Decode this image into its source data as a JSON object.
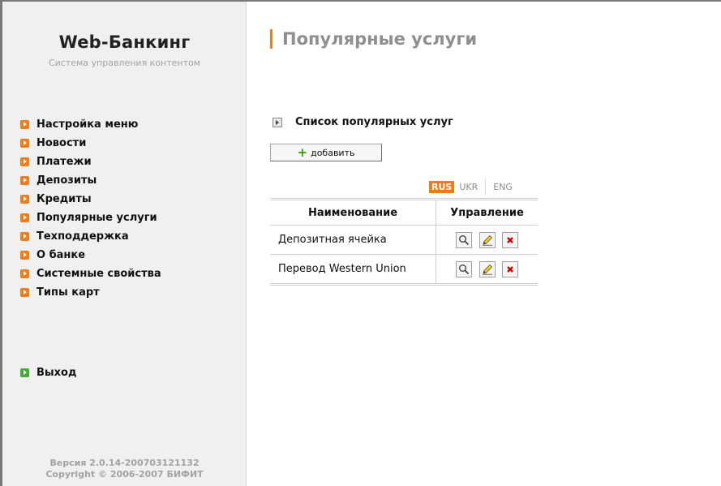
{
  "sidebar": {
    "brand_title": "Web-Банкинг",
    "brand_subtitle": "Система управления контентом",
    "items": [
      {
        "label": "Настройка меню"
      },
      {
        "label": "Новости"
      },
      {
        "label": "Платежи"
      },
      {
        "label": "Депозиты"
      },
      {
        "label": "Кредиты"
      },
      {
        "label": "Популярные услуги"
      },
      {
        "label": "Техподдержка"
      },
      {
        "label": "О банке"
      },
      {
        "label": "Системные свойства"
      },
      {
        "label": "Типы карт"
      }
    ],
    "logout_label": "Выход",
    "version": "Версия 2.0.14-200703121132",
    "copyright": "Copyright © 2006-2007 БИФИТ"
  },
  "main": {
    "title": "Популярные услуги",
    "section_title": "Список популярных услуг",
    "add_label": "добавить",
    "languages": [
      "RUS",
      "UKR",
      "ENG"
    ],
    "active_language": "RUS",
    "table": {
      "headers": [
        "Наименование",
        "Управление"
      ],
      "rows": [
        {
          "name": "Депозитная ячейка"
        },
        {
          "name": "Перевод Western Union"
        }
      ]
    }
  },
  "icons": {
    "menu_bullet": "orange-arrow-icon",
    "logout_bullet": "green-arrow-icon",
    "view": "magnifier-icon",
    "edit": "pencil-icon",
    "delete": "red-x-icon"
  },
  "colors": {
    "accent": "#f07b19",
    "logout": "#48a83b",
    "add_plus": "#31a000",
    "delete": "#cc0000"
  }
}
